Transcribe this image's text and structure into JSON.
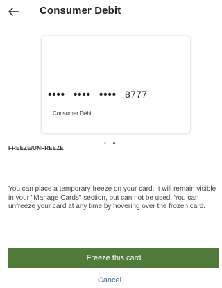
{
  "header": {
    "title": "Consumer Debit"
  },
  "card": {
    "masked_groups": [
      "••••",
      "••••",
      "••••"
    ],
    "last4": "8777",
    "name": "Consumer Debit"
  },
  "freeze_section": {
    "heading": "FREEZE/UNFREEZE",
    "description": "You can place a temporary freeze on your card. It will remain visible in your \"Manage Cards\" section, but can not be used. You can unfreeze your card at any time by hovering over the frozen card.",
    "freeze_label": "Freeze this card",
    "cancel_label": "Cancel"
  },
  "colors": {
    "primary_button": "#4f7a3a",
    "link": "#3a6b9c"
  },
  "icons": {
    "back": "arrow-left-icon"
  }
}
